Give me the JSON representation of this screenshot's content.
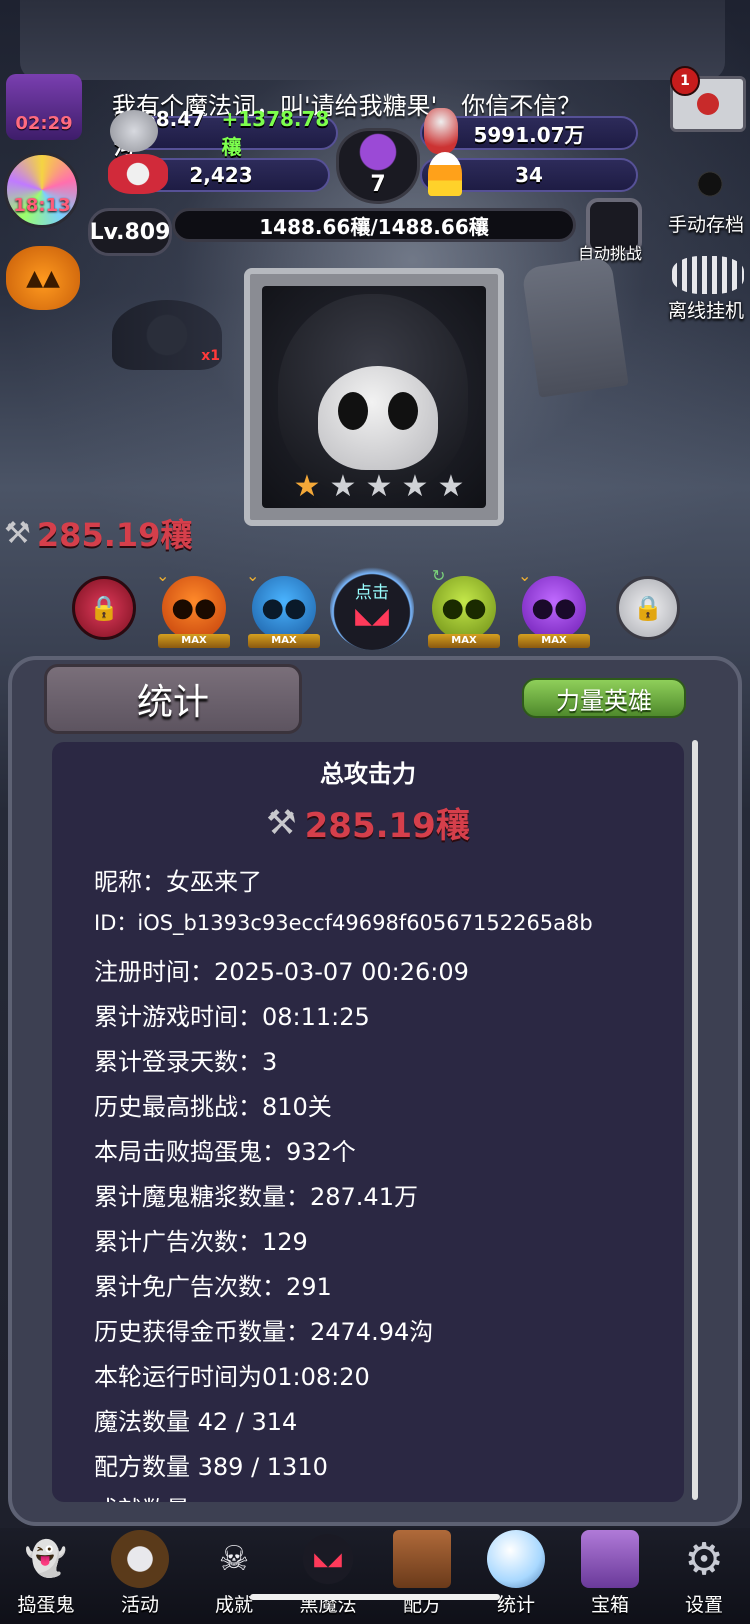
{
  "top": {
    "marquee": "我有个魔法词，叫'请给我糖果'，你信不信？",
    "witch_timer": "02:29",
    "candy_timer": "18:13",
    "gold": "2268.47沟",
    "gold_gain": "+1378.78穰",
    "top_right_value": "5991.07万",
    "skull_count": "2,423",
    "cauldron_count": "7",
    "candy_corn_count": "34",
    "mail_badge": "1",
    "level": "Lv.809",
    "hp": "1488.66穰/1488.66穰",
    "auto_challenge": "自动挑战",
    "manual_save": "手动存档",
    "offline_idle": "离线挂机"
  },
  "battle": {
    "damage_display": "285.19穰",
    "bat_multiplier": "x1",
    "stars_filled": 1,
    "stars_total": 5,
    "click_label": "点击",
    "max_label": "MAX"
  },
  "panel": {
    "tab_stats": "统计",
    "tab_heroes": "力量英雄",
    "total_attack_title": "总攻击力",
    "total_attack_value": "285.19穰",
    "stats": [
      "昵称：女巫来了",
      "ID：iOS_b1393c93eccf49698f60567152265a8b",
      "注册时间：2025-03-07 00:26:09",
      "累计游戏时间：08:11:25",
      "累计登录天数：3",
      "历史最高挑战：810关",
      "本局击败捣蛋鬼：932个",
      "累计魔鬼糖浆数量：287.41万",
      "累计广告次数：129",
      "累计免广告次数：291",
      "历史获得金币数量：2474.94沟",
      "本轮运行时间为01:08:20",
      "魔法数量 42 / 314",
      "配方数量 389 / 1310",
      "成就数量 ..."
    ]
  },
  "nav": {
    "items": [
      "捣蛋鬼",
      "活动",
      "成就",
      "黑魔法",
      "配方",
      "统计",
      "宝箱",
      "设置"
    ]
  },
  "colors": {
    "damage_red": "#d53f4b",
    "gain_green": "#7dff4d",
    "hero_tab_green": "#6fb040"
  }
}
